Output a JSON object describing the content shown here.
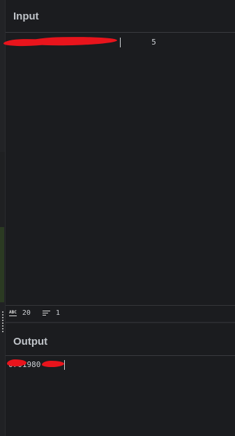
{
  "input_pane": {
    "title": "Input",
    "content_visible": "                               5"
  },
  "status": {
    "length_icon": "abc-icon",
    "length_value": "20",
    "lines_icon": "lines-icon",
    "lines_value": "1"
  },
  "output_pane": {
    "title": "Output",
    "content_visible": "0701980"
  },
  "colors": {
    "background": "#1b1c1f",
    "title_text": "#bfc3c8",
    "code_text": "#cfd2d6",
    "redaction": "#e8141c",
    "divider": "#3a3b3f"
  }
}
